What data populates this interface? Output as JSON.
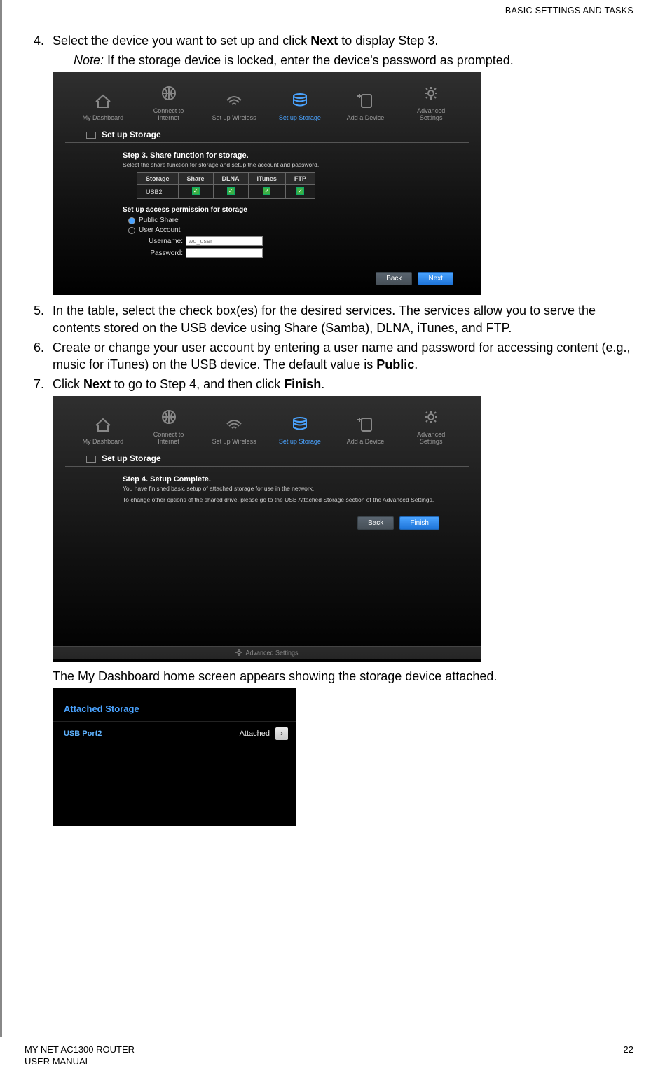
{
  "header": {
    "section": "BASIC SETTINGS AND TASKS"
  },
  "steps": {
    "s4_num": "4.",
    "s4": "Select the device you want to set up and click ",
    "s4_bold": "Next",
    "s4_after": " to display Step 3.",
    "note_label": "Note:",
    "note_text": "  If the storage device is locked, enter the device's password as prompted.",
    "s5_num": "5.",
    "s5": "In the table, select the check box(es) for the desired services. The services allow you to serve the contents stored on the USB device using Share (Samba), DLNA, iTunes, and FTP.",
    "s6_num": "6.",
    "s6_a": "Create or change your user account by entering a user name and password for accessing content (e.g., music for iTunes) on the USB device. The default value is ",
    "s6_bold": "Public",
    "s6_after": ".",
    "s7_num": "7.",
    "s7_a": "Click ",
    "s7_b1": "Next",
    "s7_mid": " to go to Step 4, and then click ",
    "s7_b2": "Finish",
    "s7_after": ".",
    "caption_ss3": "The My Dashboard home screen appears showing the storage device attached."
  },
  "ss1": {
    "nav": [
      "My Dashboard",
      "Connect to Internet",
      "Set up Wireless",
      "Set up Storage",
      "Add a Device",
      "Advanced Settings"
    ],
    "section_title": "Set up Storage",
    "step_title": "Step 3. Share function for storage.",
    "step_sub": "Select the share function for storage and setup the account and password.",
    "th": [
      "Storage",
      "Share",
      "DLNA",
      "iTunes",
      "FTP"
    ],
    "row_storage": "USB2",
    "perm_title": "Set up access permission for storage",
    "radio_public": "Public Share",
    "radio_user": "User Account",
    "username_label": "Username:",
    "username_value": "wd_user",
    "password_label": "Password:",
    "btn_back": "Back",
    "btn_next": "Next"
  },
  "ss2": {
    "nav": [
      "My Dashboard",
      "Connect to Internet",
      "Set up Wireless",
      "Set up Storage",
      "Add a Device",
      "Advanced Settings"
    ],
    "section_title": "Set up Storage",
    "step_title": "Step 4. Setup Complete.",
    "step_sub1": "You have finished basic setup of attached storage for use in the network.",
    "step_sub2": "To change other options of the shared drive, please go to the USB Attached Storage section of the Advanced Settings.",
    "btn_back": "Back",
    "btn_finish": "Finish",
    "adv_footer": "Advanced Settings"
  },
  "ss3": {
    "title": "Attached Storage",
    "port_label": "USB Port2",
    "status": "Attached"
  },
  "footer": {
    "line1": "MY NET AC1300 ROUTER",
    "line2": "USER MANUAL",
    "page": "22"
  }
}
